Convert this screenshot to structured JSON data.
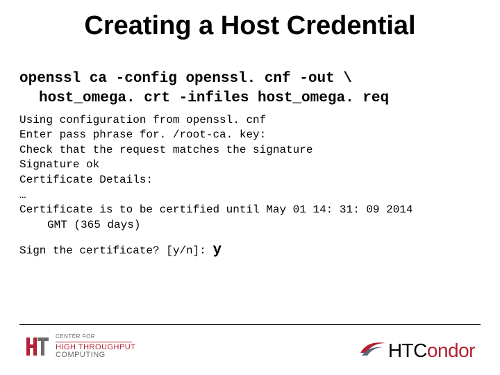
{
  "title": "Creating a Host Credential",
  "command": {
    "line1": "openssl ca -config openssl. cnf -out \\",
    "line2": "host_omega. crt -infiles host_omega. req"
  },
  "output": {
    "l1": "Using configuration from openssl. cnf",
    "l2": "Enter pass phrase for. /root-ca. key:",
    "l3": "Check that the request matches the signature",
    "l4": "Signature ok",
    "l5": "Certificate Details:",
    "l6": "…",
    "l7a": "Certificate is to be certified until May 01 14: 31: 09 2014",
    "l7b": "GMT (365 days)"
  },
  "prompt": {
    "question": "Sign the certificate? [y/n]: ",
    "answer": "y"
  },
  "footer": {
    "left": {
      "line1": "CENTER FOR",
      "line2": "HIGH THROUGHPUT",
      "line3": "COMPUTING"
    },
    "right": {
      "part1": "HTC",
      "part2": "ondor"
    }
  }
}
